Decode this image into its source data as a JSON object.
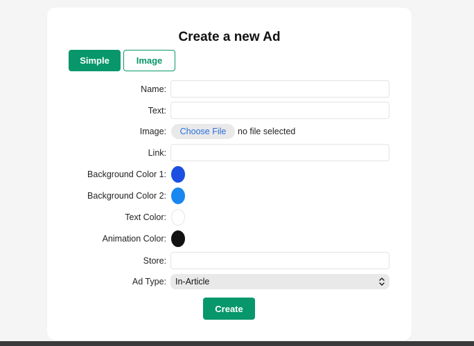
{
  "form": {
    "title": "Create a new Ad",
    "tabs": {
      "simple": "Simple",
      "image": "Image"
    },
    "name": {
      "label": "Name:",
      "value": ""
    },
    "text": {
      "label": "Text:",
      "value": ""
    },
    "image": {
      "label": "Image:",
      "button": "Choose File",
      "status": "no file selected"
    },
    "link": {
      "label": "Link:",
      "value": ""
    },
    "bg1": {
      "label": "Background Color 1:",
      "color": "#1a4fe0"
    },
    "bg2": {
      "label": "Background Color 2:",
      "color": "#1888f0"
    },
    "textColor": {
      "label": "Text Color:",
      "color": "#ffffff"
    },
    "animColor": {
      "label": "Animation Color:",
      "color": "#111111"
    },
    "store": {
      "label": "Store:",
      "value": ""
    },
    "adType": {
      "label": "Ad Type:",
      "value": "In-Article"
    },
    "submit": "Create"
  },
  "colors": {
    "accent": "#07976a"
  }
}
